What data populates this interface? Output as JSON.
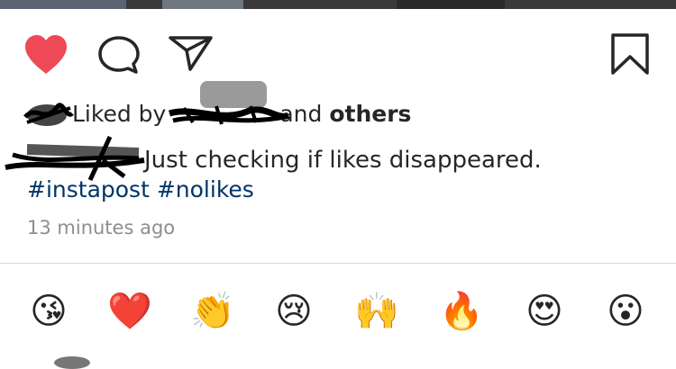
{
  "post": {
    "liked_by_prefix": "Liked by",
    "liked_by_suffix": "and",
    "liked_by_others": "others",
    "caption": "Just checking if likes disappeared.",
    "hashtags": [
      "#instapost",
      "#nolikes"
    ],
    "timestamp": "13 minutes ago"
  },
  "actions": {
    "like_icon": "heart-filled-icon",
    "comment_icon": "comment-bubble-icon",
    "share_icon": "paper-plane-icon",
    "save_icon": "bookmark-icon",
    "like_color": "#ed4956"
  },
  "quick_reactions": [
    "😘",
    "❤️",
    "👏",
    "😢",
    "🙌",
    "🔥",
    "😍",
    "😮"
  ]
}
